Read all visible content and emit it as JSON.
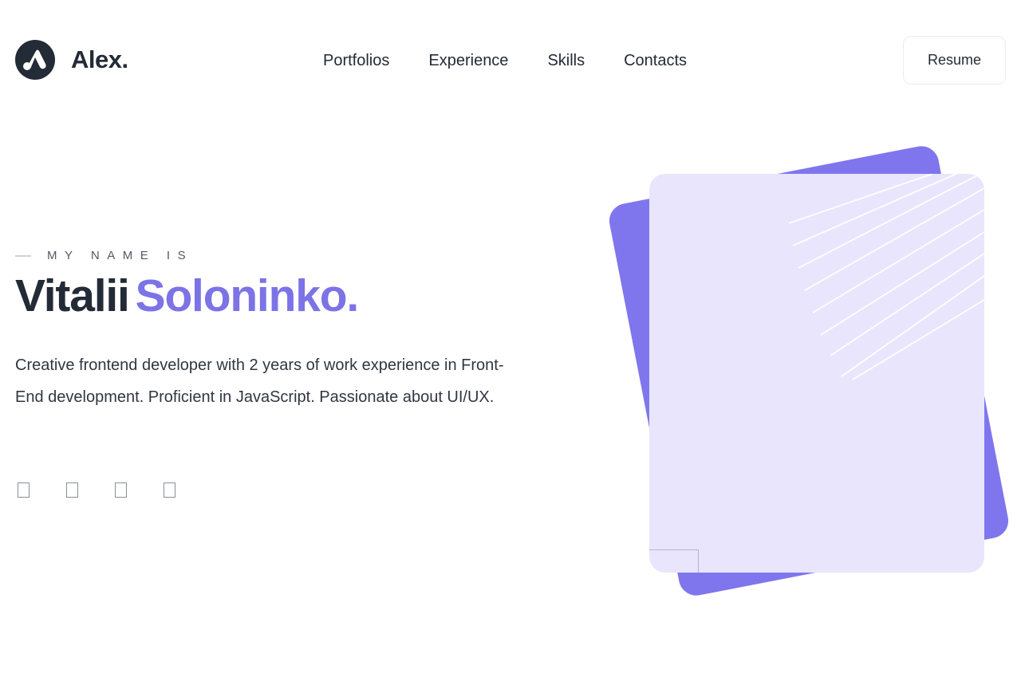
{
  "header": {
    "logo_text": "Alex.",
    "logo_icon": "alex-logo-icon",
    "nav": [
      {
        "label": "Portfolios"
      },
      {
        "label": "Experience"
      },
      {
        "label": "Skills"
      },
      {
        "label": "Contacts"
      }
    ],
    "resume_label": "Resume"
  },
  "hero": {
    "eyebrow": "MY NAME IS",
    "first_name": "Vitalii",
    "last_name": "Soloninko",
    "name_dot": ".",
    "bio": "Creative frontend developer with 2 years of work experience in Front-End development. Proficient in JavaScript. Passionate about UI/UX.",
    "socials": [
      {
        "icon": "social-icon"
      },
      {
        "icon": "social-icon"
      },
      {
        "icon": "social-icon"
      },
      {
        "icon": "social-icon"
      }
    ]
  },
  "colors": {
    "accent": "#7c73e6",
    "text": "#232b36",
    "card_back": "#7f76ee",
    "card_front": "#e8e5fc"
  }
}
